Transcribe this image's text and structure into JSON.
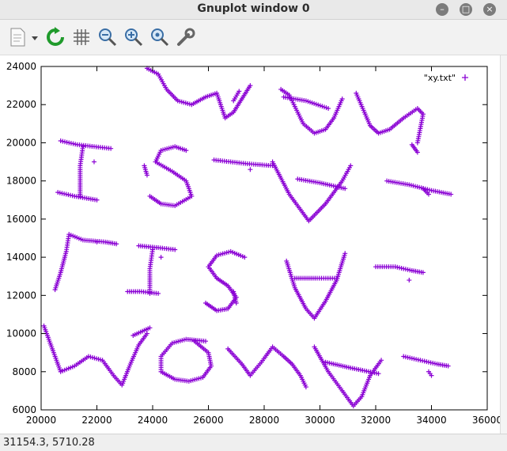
{
  "window": {
    "title": "Gnuplot window 0"
  },
  "toolbar": {
    "buttons": [
      {
        "icon": "copy-to-clipboard-icon"
      },
      {
        "icon": "replot-icon"
      },
      {
        "icon": "grid-icon"
      },
      {
        "icon": "zoom-out-icon"
      },
      {
        "icon": "zoom-in-icon"
      },
      {
        "icon": "zoom-reset-icon"
      },
      {
        "icon": "options-wrench-icon"
      }
    ]
  },
  "status": {
    "coords": "31154.3,  5710.28"
  },
  "colors": {
    "series": "#8a00d4",
    "axis": "#000000"
  },
  "chart_data": {
    "type": "scatter",
    "title": "",
    "xlabel": "",
    "ylabel": "",
    "xlim": [
      20000,
      36000
    ],
    "ylim": [
      6000,
      24000
    ],
    "x_ticks": [
      "20000",
      "22000",
      "24000",
      "26000",
      "28000",
      "30000",
      "32000",
      "34000",
      "36000"
    ],
    "y_ticks": [
      "6000",
      "8000",
      "10000",
      "12000",
      "14000",
      "16000",
      "18000",
      "20000",
      "22000",
      "24000"
    ],
    "legend_position": "top-right",
    "series": [
      {
        "name": "\"xy.txt\"",
        "marker": "plus",
        "strokes": [
          [
            [
              23800,
              23900
            ],
            [
              24200,
              23600
            ],
            [
              24500,
              22800
            ],
            [
              24900,
              22200
            ],
            [
              25400,
              22000
            ],
            [
              25900,
              22400
            ],
            [
              26300,
              22600
            ],
            [
              26600,
              21300
            ],
            [
              26900,
              21600
            ],
            [
              27200,
              22300
            ],
            [
              27500,
              23000
            ]
          ],
          [
            [
              26900,
              22200
            ],
            [
              27100,
              22700
            ]
          ],
          [
            [
              28600,
              22800
            ],
            [
              28900,
              22500
            ],
            [
              29400,
              21000
            ],
            [
              29800,
              20500
            ],
            [
              30200,
              20700
            ],
            [
              30500,
              21300
            ],
            [
              30800,
              22300
            ]
          ],
          [
            [
              28700,
              22400
            ],
            [
              29500,
              22200
            ],
            [
              30300,
              21800
            ]
          ],
          [
            [
              31300,
              22600
            ],
            [
              31800,
              20900
            ],
            [
              32100,
              20500
            ],
            [
              32500,
              20700
            ],
            [
              33000,
              21300
            ],
            [
              33500,
              21800
            ],
            [
              33700,
              21500
            ],
            [
              33500,
              20000
            ]
          ],
          [
            [
              33300,
              19900
            ],
            [
              33500,
              19500
            ]
          ],
          [
            [
              20700,
              20100
            ],
            [
              21300,
              19900
            ],
            [
              22500,
              19700
            ]
          ],
          [
            [
              21500,
              19800
            ],
            [
              21400,
              18800
            ],
            [
              21400,
              17200
            ]
          ],
          [
            [
              20600,
              17400
            ],
            [
              21200,
              17200
            ],
            [
              22000,
              17000
            ]
          ],
          [
            [
              21900,
              19000
            ]
          ],
          [
            [
              25200,
              19600
            ],
            [
              24800,
              19800
            ],
            [
              24300,
              19600
            ],
            [
              24100,
              19000
            ],
            [
              24700,
              18500
            ],
            [
              25200,
              18000
            ],
            [
              25400,
              17200
            ],
            [
              24800,
              16700
            ],
            [
              24300,
              16800
            ],
            [
              23900,
              17200
            ]
          ],
          [
            [
              23800,
              18300
            ],
            [
              23700,
              18800
            ]
          ],
          [
            [
              26200,
              19100
            ],
            [
              26800,
              19000
            ],
            [
              27400,
              18900
            ],
            [
              28300,
              18800
            ]
          ],
          [
            [
              27500,
              18600
            ]
          ],
          [
            [
              28300,
              19000
            ],
            [
              28900,
              17300
            ],
            [
              29600,
              15900
            ],
            [
              30200,
              16800
            ],
            [
              30800,
              18000
            ],
            [
              31100,
              18800
            ]
          ],
          [
            [
              29200,
              18100
            ],
            [
              30000,
              17900
            ],
            [
              30900,
              17600
            ]
          ],
          [
            [
              32400,
              18000
            ],
            [
              33200,
              17800
            ],
            [
              34000,
              17500
            ],
            [
              34700,
              17300
            ]
          ],
          [
            [
              33700,
              17600
            ],
            [
              33900,
              17300
            ]
          ],
          [
            [
              20500,
              12300
            ],
            [
              20700,
              13200
            ],
            [
              20900,
              14300
            ],
            [
              21000,
              15200
            ],
            [
              21500,
              14900
            ],
            [
              22300,
              14800
            ],
            [
              22700,
              14700
            ]
          ],
          [
            [
              22000,
              14800
            ]
          ],
          [
            [
              23500,
              14600
            ],
            [
              24200,
              14500
            ],
            [
              24800,
              14400
            ]
          ],
          [
            [
              24000,
              14400
            ],
            [
              23900,
              13400
            ],
            [
              23900,
              12100
            ]
          ],
          [
            [
              23100,
              12200
            ],
            [
              23600,
              12200
            ],
            [
              24200,
              12100
            ]
          ],
          [
            [
              24300,
              14000
            ]
          ],
          [
            [
              27300,
              14000
            ],
            [
              26800,
              14300
            ],
            [
              26300,
              14100
            ],
            [
              26000,
              13500
            ],
            [
              26300,
              12900
            ],
            [
              26700,
              12500
            ],
            [
              27000,
              11900
            ],
            [
              26700,
              11300
            ],
            [
              26300,
              11200
            ],
            [
              25900,
              11600
            ]
          ],
          [
            [
              26900,
              12200
            ],
            [
              27000,
              11600
            ]
          ],
          [
            [
              28800,
              13800
            ],
            [
              29100,
              12400
            ],
            [
              29500,
              11300
            ],
            [
              29800,
              10800
            ],
            [
              30200,
              11700
            ],
            [
              30600,
              12800
            ],
            [
              30900,
              14200
            ]
          ],
          [
            [
              29100,
              12900
            ],
            [
              29900,
              12900
            ],
            [
              30600,
              12900
            ]
          ],
          [
            [
              32000,
              13500
            ],
            [
              32700,
              13500
            ],
            [
              33300,
              13300
            ],
            [
              33700,
              13200
            ]
          ],
          [
            [
              33200,
              12800
            ]
          ],
          [
            [
              20100,
              10400
            ],
            [
              20400,
              9200
            ],
            [
              20700,
              8000
            ],
            [
              21200,
              8300
            ],
            [
              21700,
              8800
            ],
            [
              22200,
              8600
            ],
            [
              22600,
              7800
            ],
            [
              22900,
              7300
            ],
            [
              23200,
              8400
            ],
            [
              23500,
              9400
            ],
            [
              23800,
              10000
            ]
          ],
          [
            [
              23900,
              10300
            ],
            [
              23300,
              9900
            ]
          ],
          [
            [
              25900,
              9600
            ],
            [
              25200,
              9700
            ],
            [
              24700,
              9500
            ],
            [
              24300,
              8800
            ],
            [
              24300,
              8000
            ],
            [
              24800,
              7600
            ],
            [
              25300,
              7500
            ],
            [
              25800,
              7700
            ],
            [
              26100,
              8300
            ],
            [
              26000,
              9000
            ],
            [
              25500,
              9600
            ]
          ],
          [
            [
              26700,
              9200
            ],
            [
              27200,
              8400
            ],
            [
              27500,
              7800
            ],
            [
              27900,
              8500
            ],
            [
              28300,
              9300
            ],
            [
              28700,
              8800
            ],
            [
              29000,
              8400
            ],
            [
              29300,
              7800
            ],
            [
              29500,
              7200
            ]
          ],
          [
            [
              29800,
              9300
            ],
            [
              30300,
              8000
            ],
            [
              30800,
              7000
            ],
            [
              31200,
              6200
            ],
            [
              31500,
              6700
            ],
            [
              31800,
              7800
            ],
            [
              32200,
              8600
            ]
          ],
          [
            [
              30200,
              8500
            ],
            [
              31100,
              8200
            ],
            [
              32100,
              7900
            ]
          ],
          [
            [
              33000,
              8800
            ],
            [
              33600,
              8600
            ],
            [
              34200,
              8400
            ],
            [
              34600,
              8300
            ]
          ],
          [
            [
              33900,
              8000
            ],
            [
              34000,
              7800
            ]
          ]
        ]
      }
    ]
  }
}
